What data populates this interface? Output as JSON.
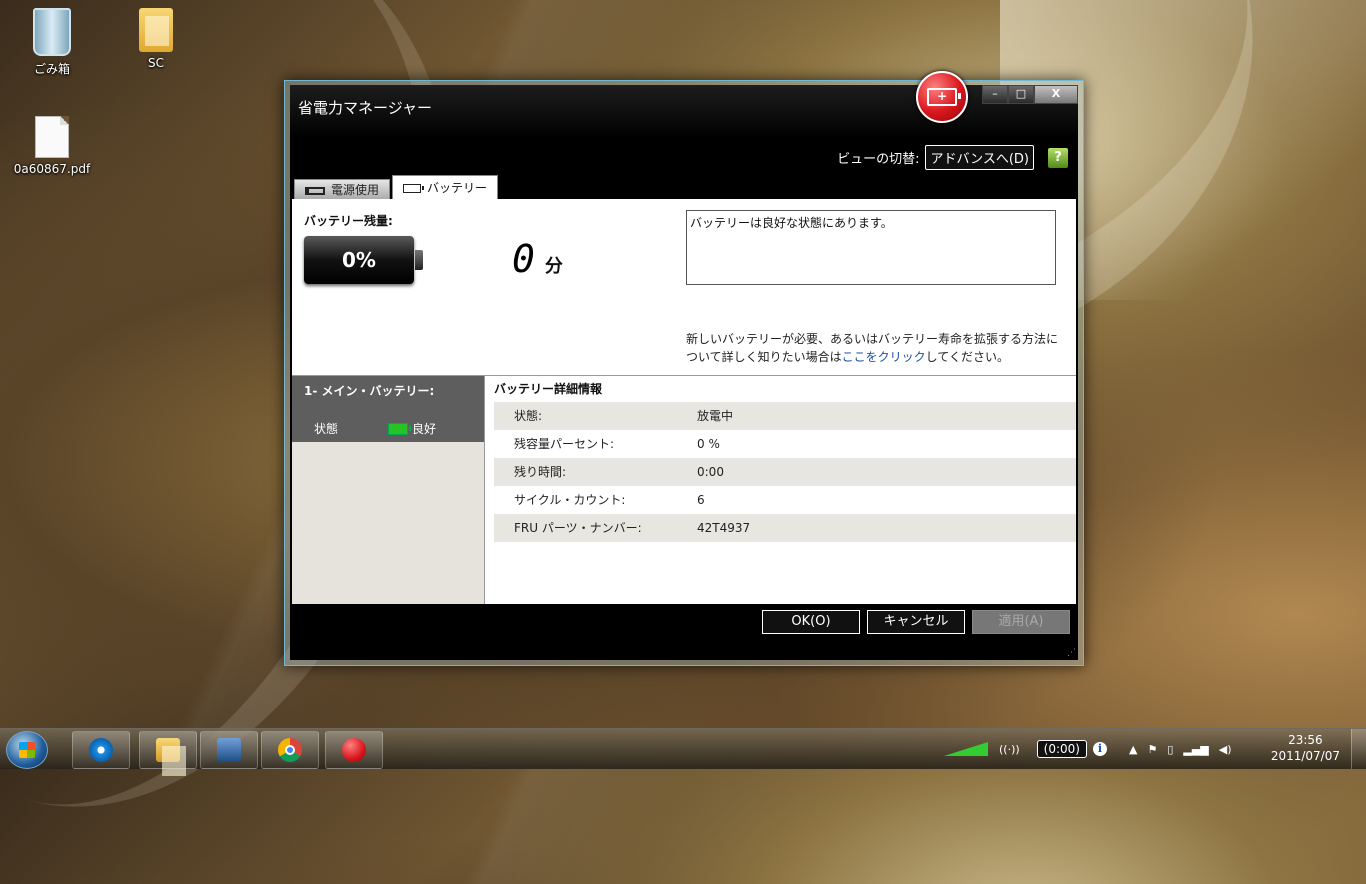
{
  "desktop": {
    "icons": [
      {
        "label": "ごみ箱"
      },
      {
        "label": "SC"
      },
      {
        "label": "0a60867.pdf"
      }
    ]
  },
  "window": {
    "title": "省電力マネージャー",
    "controls": {
      "minimize": "–",
      "maximize": "□",
      "close": "X"
    },
    "view_switch": {
      "label": "ビューの切替:",
      "button": "アドバンスへ(D)",
      "help": "?"
    },
    "tabs": [
      {
        "label": "電源使用",
        "active": false
      },
      {
        "label": "バッテリー",
        "active": true
      }
    ],
    "battery": {
      "remaining_label": "バッテリー残量:",
      "percent_text": "0%",
      "minutes_value": "0",
      "minutes_unit": "分",
      "status_message": "バッテリーは良好な状態にあります。",
      "new_battery_text_pre": "新しいバッテリーが必要、あるいはバッテリー寿命を拡張する方法について詳しく知りたい場合は",
      "new_battery_link": "ここをクリック",
      "new_battery_text_post": "してください。"
    },
    "battery_list": {
      "header": "1- メイン・バッテリー:",
      "status_key": "状態",
      "status_value": "良好"
    },
    "details": {
      "header": "バッテリー詳細情報",
      "rows": [
        {
          "key": "状態:",
          "value": "放電中"
        },
        {
          "key": "残容量パーセント:",
          "value": "0 %"
        },
        {
          "key": "残り時間:",
          "value": "0:00"
        },
        {
          "key": "サイクル・カウント:",
          "value": "6"
        },
        {
          "key": "FRU パーツ・ナンバー:",
          "value": "42T4937"
        }
      ]
    },
    "buttons": {
      "ok": "OK(O)",
      "cancel": "キャンセル",
      "apply": "適用(A)"
    }
  },
  "taskbar": {
    "battery_pill": "(0:00)",
    "info_icon": "i",
    "clock_time": "23:56",
    "clock_date": "2011/07/07"
  }
}
